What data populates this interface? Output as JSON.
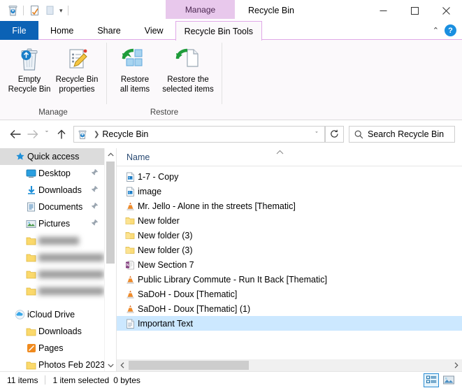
{
  "window": {
    "title": "Recycle Bin",
    "contextual_tab_header": "Manage",
    "minimize_label": "Minimize",
    "maximize_label": "Maximize",
    "close_label": "Close"
  },
  "quick_access_toolbar": {
    "items": [
      {
        "name": "recycle-bin-icon",
        "label": "Recycle Bin"
      },
      {
        "name": "properties-icon",
        "label": "Properties"
      },
      {
        "name": "new-folder-icon",
        "label": "New folder"
      }
    ],
    "customize_caret": "▾"
  },
  "tabs": [
    {
      "label": "File",
      "active": false,
      "kind": "file"
    },
    {
      "label": "Home",
      "active": false,
      "kind": "normal"
    },
    {
      "label": "Share",
      "active": false,
      "kind": "normal"
    },
    {
      "label": "View",
      "active": false,
      "kind": "normal"
    },
    {
      "label": "Recycle Bin Tools",
      "active": true,
      "kind": "contextual"
    }
  ],
  "ribbon": {
    "collapse_caret": "⌃",
    "help_label": "?",
    "groups": [
      {
        "label": "Manage",
        "buttons": [
          {
            "name": "empty-recycle-bin-button",
            "line1": "Empty",
            "line2": "Recycle Bin",
            "icon": "recycle-bin-icon"
          },
          {
            "name": "recycle-bin-properties-button",
            "line1": "Recycle Bin",
            "line2": "properties",
            "icon": "properties-pencil-icon"
          }
        ]
      },
      {
        "label": "Restore",
        "buttons": [
          {
            "name": "restore-all-items-button",
            "line1": "Restore",
            "line2": "all items",
            "icon": "restore-all-icon"
          },
          {
            "name": "restore-selected-items-button",
            "line1": "Restore the",
            "line2": "selected items",
            "icon": "restore-selected-icon"
          }
        ]
      }
    ]
  },
  "addressbar": {
    "back_label": "Back",
    "forward_label": "Forward",
    "recent_caret": "ˇ",
    "up_label": "Up",
    "breadcrumb": {
      "icon": "recycle-bin-icon",
      "separator": "❯",
      "path": "Recycle Bin",
      "dropdown_caret": "ˇ"
    },
    "refresh_label": "↺",
    "search": {
      "icon": "search-icon",
      "placeholder": "Search Recycle Bin",
      "value": ""
    }
  },
  "sidebar": {
    "items": [
      {
        "label": "Quick access",
        "icon": "star-pin-icon",
        "indent": 1,
        "selected": true,
        "pinned": false,
        "blurred": false
      },
      {
        "label": "Desktop",
        "icon": "desktop-icon",
        "indent": 2,
        "selected": false,
        "pinned": true,
        "blurred": false
      },
      {
        "label": "Downloads",
        "icon": "downloads-arrow-icon",
        "indent": 2,
        "selected": false,
        "pinned": true,
        "blurred": false
      },
      {
        "label": "Documents",
        "icon": "documents-icon",
        "indent": 2,
        "selected": false,
        "pinned": true,
        "blurred": false
      },
      {
        "label": "Pictures",
        "icon": "pictures-icon",
        "indent": 2,
        "selected": false,
        "pinned": true,
        "blurred": false
      },
      {
        "label": "",
        "icon": "folder-icon",
        "indent": 2,
        "selected": false,
        "pinned": false,
        "blurred": true,
        "blur_width": 58
      },
      {
        "label": "",
        "icon": "folder-icon",
        "indent": 2,
        "selected": false,
        "pinned": false,
        "blurred": true,
        "blur_width": 110
      },
      {
        "label": "",
        "icon": "folder-icon",
        "indent": 2,
        "selected": false,
        "pinned": false,
        "blurred": true,
        "blur_width": 104
      },
      {
        "label": "",
        "icon": "folder-icon",
        "indent": 2,
        "selected": false,
        "pinned": false,
        "blurred": true,
        "blur_width": 96
      },
      {
        "label": "iCloud Drive",
        "icon": "icloud-icon",
        "indent": 1,
        "selected": false,
        "pinned": false,
        "blurred": false
      },
      {
        "label": "Downloads",
        "icon": "folder-icon",
        "indent": 2,
        "selected": false,
        "pinned": false,
        "blurred": false
      },
      {
        "label": "Pages",
        "icon": "pages-app-icon",
        "indent": 2,
        "selected": false,
        "pinned": false,
        "blurred": false
      },
      {
        "label": "Photos Feb 2023",
        "icon": "folder-icon",
        "indent": 2,
        "selected": false,
        "pinned": false,
        "blurred": false
      }
    ],
    "scroll_up": "⌃",
    "scroll_down": "⌄"
  },
  "filepane": {
    "columns": [
      {
        "label": "Name",
        "sort": "ascending",
        "sort_caret": "⌃"
      }
    ],
    "rows": [
      {
        "name": "1-7 - Copy",
        "icon": "image-file-icon",
        "selected": false
      },
      {
        "name": "image",
        "icon": "image-file-icon",
        "selected": false
      },
      {
        "name": "Mr. Jello - Alone in the streets [Thematic]",
        "icon": "vlc-media-icon",
        "selected": false
      },
      {
        "name": "New folder",
        "icon": "folder-icon",
        "selected": false
      },
      {
        "name": "New folder (3)",
        "icon": "folder-icon",
        "selected": false
      },
      {
        "name": "New folder (3)",
        "icon": "folder-icon",
        "selected": false
      },
      {
        "name": "New Section 7",
        "icon": "onenote-section-icon",
        "selected": false
      },
      {
        "name": "Public Library Commute - Run It Back [Thematic]",
        "icon": "vlc-media-icon",
        "selected": false
      },
      {
        "name": "SaDoH - Doux [Thematic]",
        "icon": "vlc-media-icon",
        "selected": false
      },
      {
        "name": "SaDoH - Doux [Thematic] (1)",
        "icon": "vlc-media-icon",
        "selected": false
      },
      {
        "name": "Important Text",
        "icon": "text-file-icon",
        "selected": true
      }
    ],
    "hscroll_left": "❮",
    "hscroll_right": "❯"
  },
  "statusbar": {
    "item_count": "11 items",
    "selection": "1 item selected",
    "selection_size": "0 bytes",
    "views": [
      {
        "name": "details-view-button",
        "label": "Details view",
        "active": true
      },
      {
        "name": "large-icons-view-button",
        "label": "Large icons view",
        "active": false
      }
    ]
  },
  "colors": {
    "file_tab_blue": "#0b62b5",
    "contextual_purple": "#e8c8ec",
    "selection_blue": "#cce8ff",
    "sidebar_selection": "#dcdcdc",
    "accent_link": "#2a4a73",
    "help_blue": "#1a8fe0"
  }
}
